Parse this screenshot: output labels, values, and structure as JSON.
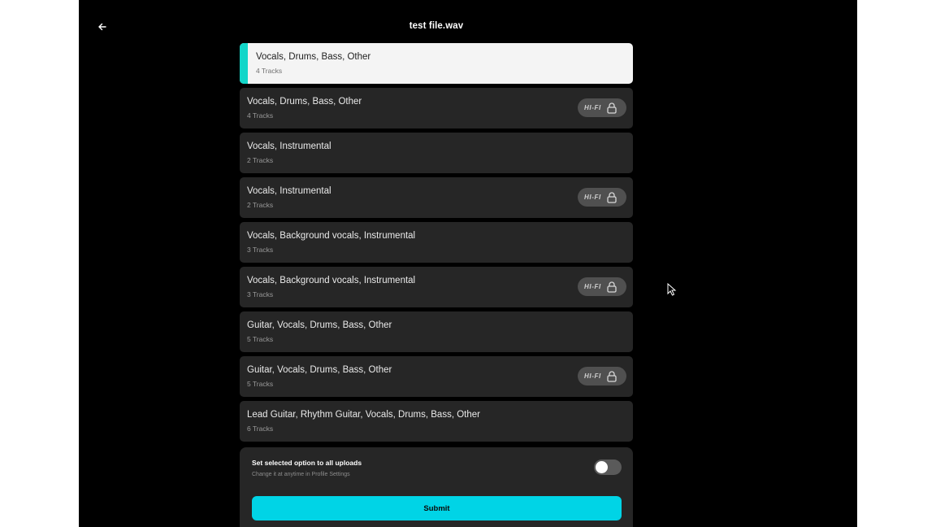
{
  "header": {
    "title": "test file.wav"
  },
  "options": [
    {
      "label": "Vocals, Drums, Bass, Other",
      "tracks": "4 Tracks",
      "selected": true,
      "hifi": false
    },
    {
      "label": "Vocals, Drums, Bass, Other",
      "tracks": "4 Tracks",
      "selected": false,
      "hifi": true
    },
    {
      "label": "Vocals, Instrumental",
      "tracks": "2 Tracks",
      "selected": false,
      "hifi": false
    },
    {
      "label": "Vocals, Instrumental",
      "tracks": "2 Tracks",
      "selected": false,
      "hifi": true
    },
    {
      "label": "Vocals, Background vocals, Instrumental",
      "tracks": "3 Tracks",
      "selected": false,
      "hifi": false
    },
    {
      "label": "Vocals, Background vocals, Instrumental",
      "tracks": "3 Tracks",
      "selected": false,
      "hifi": true
    },
    {
      "label": "Guitar, Vocals, Drums, Bass, Other",
      "tracks": "5 Tracks",
      "selected": false,
      "hifi": false
    },
    {
      "label": "Guitar, Vocals, Drums, Bass, Other",
      "tracks": "5 Tracks",
      "selected": false,
      "hifi": true
    },
    {
      "label": "Lead Guitar, Rhythm Guitar, Vocals, Drums, Bass, Other",
      "tracks": "6 Tracks",
      "selected": false,
      "hifi": false
    }
  ],
  "badge": {
    "hifi_label": "HI-FI"
  },
  "settings": {
    "title": "Set selected option to all uploads",
    "subtitle": "Change it at anytime in Profile Settings",
    "toggle_on": false
  },
  "submit": {
    "label": "Submit"
  },
  "colors": {
    "accent": "#12d6c9",
    "submit_bg": "#00d4e6",
    "card_bg": "#262626",
    "selected_bg": "#f4f4f4"
  },
  "icons": {
    "back": "arrow-left-icon",
    "lock": "lock-icon",
    "cursor": "mouse-pointer-icon"
  }
}
